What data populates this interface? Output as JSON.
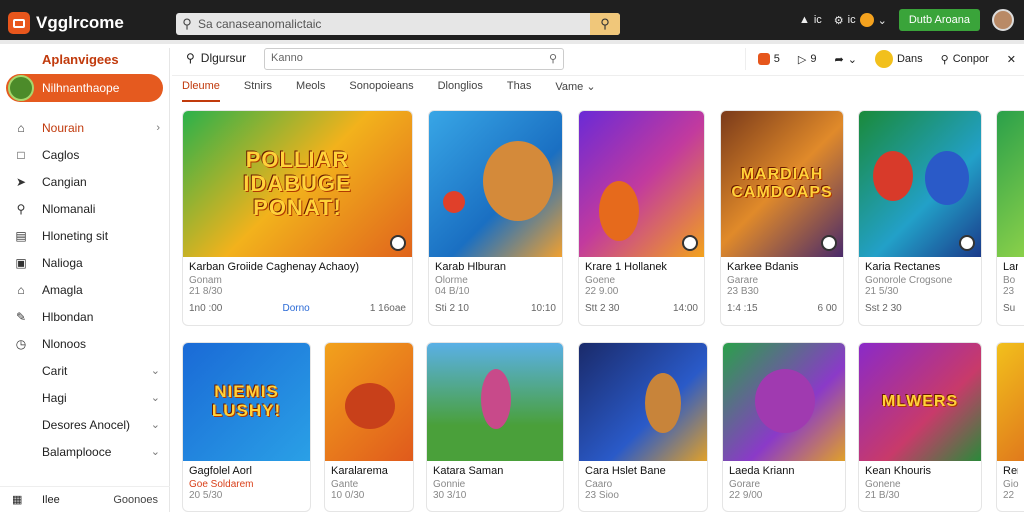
{
  "app": {
    "title": "Vgglrcome"
  },
  "search": {
    "text": "Sa canaseanomalictaic"
  },
  "topbar": {
    "items": [
      "ic",
      "ic"
    ],
    "cta": "Dutb Aroana"
  },
  "sidebar": {
    "title": "Aplanvigees",
    "pill": "Nilhnanthaope",
    "items": [
      {
        "icon": "home-icon",
        "label": "Nourain",
        "chev": "›",
        "active": true
      },
      {
        "icon": "square-icon",
        "label": "Caglos"
      },
      {
        "icon": "tag-icon",
        "label": "Cangian"
      },
      {
        "icon": "search-icon",
        "label": "Nlomanali"
      },
      {
        "icon": "book-icon",
        "label": "Hloneting sit"
      },
      {
        "icon": "image-icon",
        "label": "Nalioga"
      },
      {
        "icon": "home-alt-icon",
        "label": "Amagla"
      },
      {
        "icon": "edit-icon",
        "label": "Hlbondan"
      },
      {
        "icon": "clock-icon",
        "label": "Nlonoos"
      }
    ],
    "subitems": [
      {
        "label": "Carit",
        "chev": "⌄"
      },
      {
        "label": "Hagi",
        "chev": "⌄"
      },
      {
        "label": "Desores Anocel)",
        "chev": "⌄"
      },
      {
        "label": "Balamplooce",
        "chev": "⌄"
      }
    ],
    "footer": {
      "label": "Ilee",
      "right": "Goonoes"
    }
  },
  "content": {
    "search_label": "Dlgursur",
    "search_placeholder": "Kanno",
    "right": [
      {
        "label": "5"
      },
      {
        "label": "9"
      },
      {
        "label": ""
      },
      {
        "label": "Dans"
      },
      {
        "label": "Conpor"
      }
    ]
  },
  "tabs": [
    "Dleume",
    "Stnirs",
    "Meols",
    "Sonopoieans",
    "Dlonglios",
    "Thas",
    "Vame"
  ],
  "cards_row1": [
    {
      "title_art": "POLLIAR IDABUGE PONAT!",
      "name": "Karban Groiide Caghenay Achaoy)",
      "sub": "Gonam",
      "sub2": "21 8/30",
      "left": "1n0 :00",
      "mid": "Dorno",
      "right": "1 16oae"
    },
    {
      "title_art": "",
      "name": "Karab Hlburan",
      "sub": "Olorme",
      "sub2": "04 B/10",
      "left": "Sti 2 10",
      "mid": "",
      "right": "10:10"
    },
    {
      "title_art": "",
      "name": "Krare 1 Hollanek",
      "sub": "Goene",
      "sub2": "22 9.00",
      "left": "Stt 2 30",
      "mid": "",
      "right": "14:00"
    },
    {
      "title_art": "MARDIAH CAMDOAPS",
      "name": "Karkee Bdanis",
      "sub": "Garare",
      "sub2": "23 B30",
      "left": "1:4 :15",
      "mid": "",
      "right": "6 00"
    },
    {
      "title_art": "",
      "name": "Karia Rectanes",
      "sub": "Gonorole Crogsone",
      "sub2": "21 5/30",
      "left": "Sst 2 30",
      "mid": "",
      "right": ""
    },
    {
      "title_art": "",
      "name": "Lar",
      "sub": "Bo",
      "sub2": "23",
      "left": "Su",
      "mid": "",
      "right": ""
    }
  ],
  "cards_row2": [
    {
      "title_art": "NIEMIS LUSHY!",
      "name": "Gagfolel Aorl",
      "sub": "Goe Soldarem",
      "sub2": "20 5/30"
    },
    {
      "title_art": "",
      "name": "Karalarema",
      "sub": "Gante",
      "sub2": "10 0/30"
    },
    {
      "title_art": "",
      "name": "Katara Saman",
      "sub": "Gonnie",
      "sub2": "30 3/10"
    },
    {
      "title_art": "",
      "name": "Cara Hslet Bane",
      "sub": "Caaro",
      "sub2": "23 Sioo"
    },
    {
      "title_art": "",
      "name": "Laeda Kriann",
      "sub": "Gorare",
      "sub2": "22 9/00"
    },
    {
      "title_art": "MLWERS",
      "name": "Kean Khouris",
      "sub": "Gonene",
      "sub2": "21 B/30"
    },
    {
      "title_art": "",
      "name": "Rer",
      "sub": "Gio",
      "sub2": "22"
    }
  ],
  "colors": {
    "accent": "#e55a1f",
    "topbar": "#1f1f1f",
    "active_tab": "#c13a0c"
  }
}
